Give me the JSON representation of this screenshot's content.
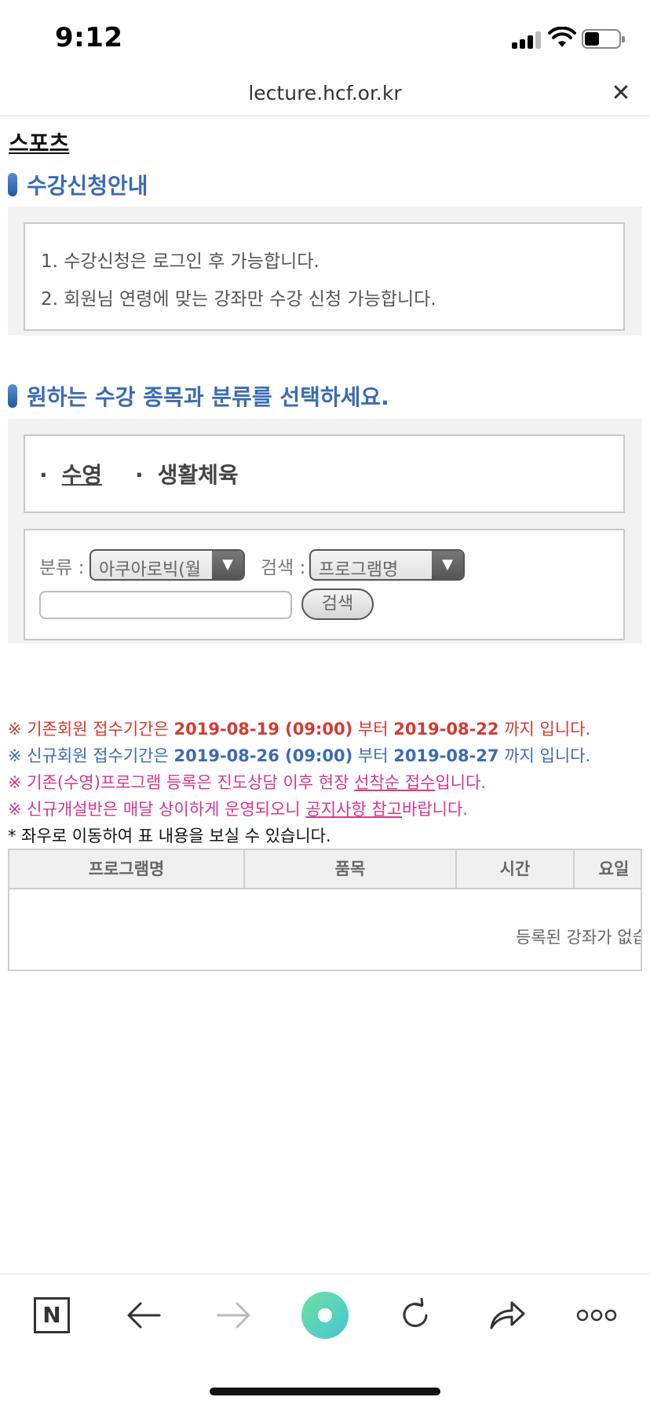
{
  "status_bar": {
    "time": "9:12"
  },
  "url_bar": {
    "url": "lecture.hcf.or.kr"
  },
  "page": {
    "title": "스포츠"
  },
  "guide": {
    "heading": "수강신청안내",
    "lines": [
      "1. 수강신청은 로그인 후 가능합니다.",
      "2. 회원님 연령에 맞는 강좌만 수강 신청 가능합니다."
    ]
  },
  "selection": {
    "heading": "원하는 수강 종목과 분류를 선택하세요.",
    "sports": [
      {
        "label": "수영",
        "active": true
      },
      {
        "label": "생활체육",
        "active": false
      }
    ],
    "category_label": "분류 :",
    "category_value": "아쿠아로빅(월",
    "search_label": "검색 :",
    "search_type_value": "프로그램명",
    "search_input_value": "",
    "search_button": "검색"
  },
  "info": {
    "line1": {
      "a": "※ 기존회원 접수기간은 ",
      "b": "2019-08-19 (09:00)",
      "c": " 부터 ",
      "d": "2019-08-22",
      "e": " 까지 입니다."
    },
    "line2": {
      "a": "※ 신규회원 접수기간은 ",
      "b": "2019-08-26 (09:00)",
      "c": " 부터 ",
      "d": "2019-08-27",
      "e": " 까지 입니다."
    },
    "line3": {
      "a": "※ 기존(수영)프로그램 등록은 진도상담 이후 현장 ",
      "b": "선착순 접수",
      "c": "입니다."
    },
    "line4": {
      "a": "※ 신규개설반은 매달 상이하게 운영되오니 ",
      "b": "공지사항 참고",
      "c": "바랍니다."
    },
    "line5": "* 좌우로 이동하여 표 내용을 보실 수 있습니다."
  },
  "table": {
    "headers": [
      "프로그램명",
      "품목",
      "시간",
      "요일"
    ],
    "empty_message": "등록된 강좌가 없습"
  },
  "toolbar": {
    "icons": [
      "naver-icon",
      "back-arrow-icon",
      "forward-arrow-icon",
      "home-circle-icon",
      "reload-icon",
      "share-icon",
      "more-icon"
    ],
    "n_label": "N"
  },
  "colors": {
    "heading_blue": "#3b6bb3",
    "notice_red": "#d43a30",
    "notice_pink": "#d6378a"
  }
}
